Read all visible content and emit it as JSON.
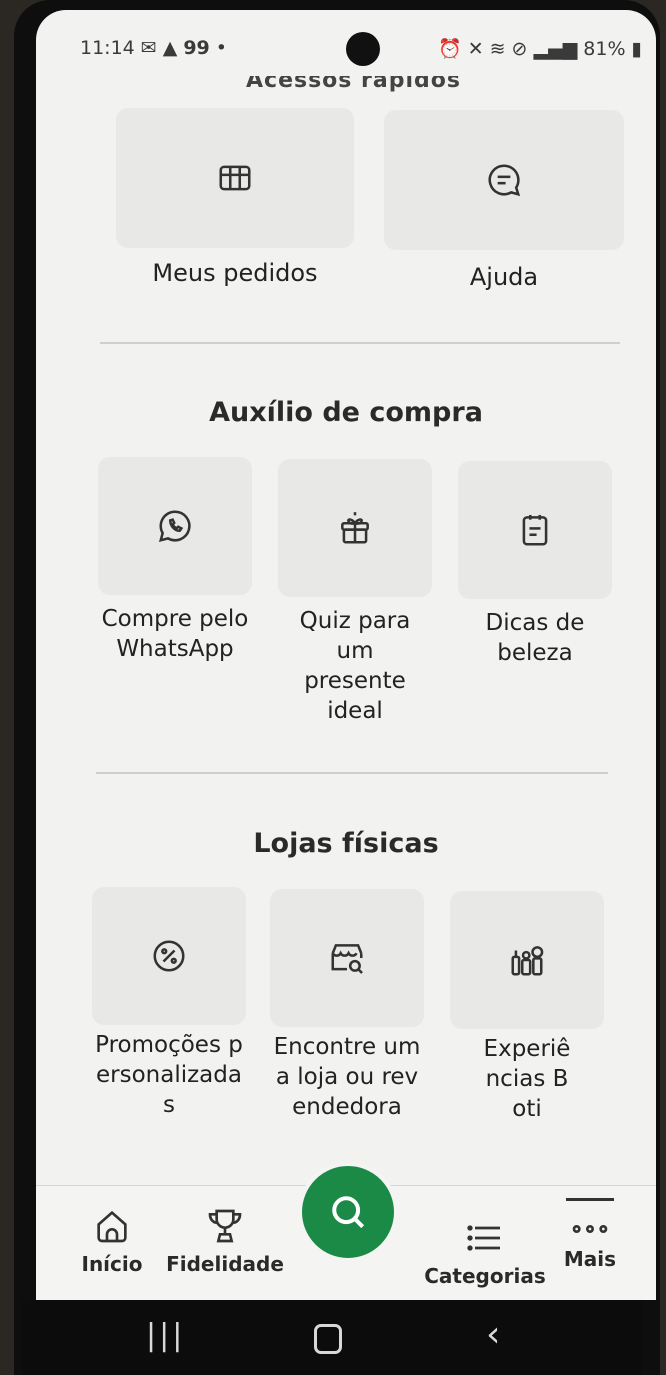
{
  "status": {
    "time": "11:14",
    "notif_count": "99",
    "battery": "81%"
  },
  "peek_title": "Acessos rápidos",
  "quick_access": [
    {
      "label": "Meus pedidos",
      "icon": "orders-grid-icon"
    },
    {
      "label": "Ajuda",
      "icon": "chat-bubble-icon"
    }
  ],
  "purchase_help": {
    "title": "Auxílio de compra",
    "items": [
      {
        "label": "Compre pelo WhatsApp",
        "icon": "whatsapp-icon"
      },
      {
        "label": "Quiz para um presente ideal",
        "icon": "gift-icon"
      },
      {
        "label": "Dicas de beleza",
        "icon": "notepad-icon"
      }
    ]
  },
  "stores": {
    "title": "Lojas físicas",
    "items": [
      {
        "label": "Promoções personalizadas",
        "icon": "discount-percent-icon"
      },
      {
        "label": "Encontre uma loja ou revendedora",
        "icon": "store-search-icon"
      },
      {
        "label": "Experiências Boti",
        "icon": "beauty-products-icon"
      }
    ]
  },
  "nav": {
    "home": "Início",
    "loyalty": "Fidelidade",
    "categories": "Categorias",
    "more": "Mais"
  },
  "colors": {
    "accent": "#1b8a46",
    "background": "#f2f2f0",
    "tile": "#e8e8e6"
  }
}
